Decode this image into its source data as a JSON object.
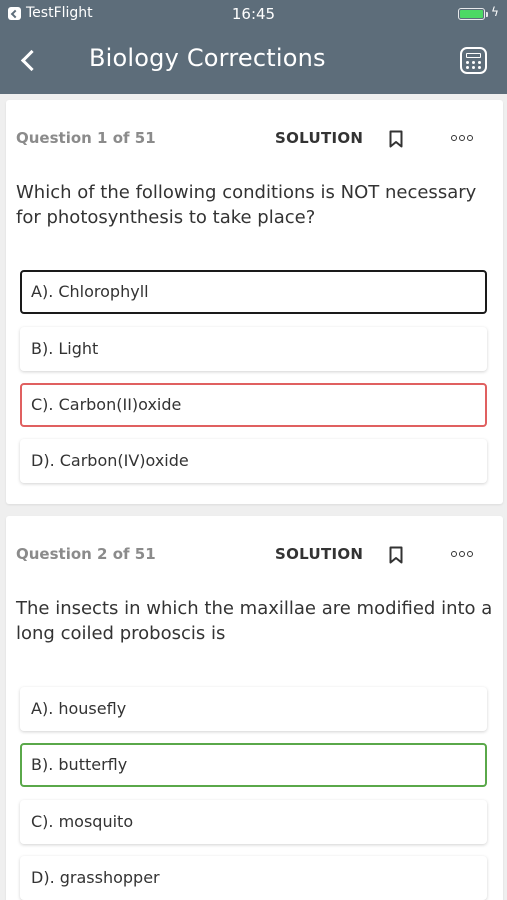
{
  "status_bar": {
    "app": "TestFlight",
    "time": "16:45",
    "charging_icon": "bolt-icon"
  },
  "header": {
    "title": "Biology Corrections",
    "back_icon": "chevron-left-icon",
    "calculator_icon": "calculator-icon"
  },
  "colors": {
    "header_bg": "#5d6d7a",
    "selected_border": "#1a1a1a",
    "wrong_border": "#e06060",
    "correct_border": "#5aa84a"
  },
  "questions": [
    {
      "counter": "Question 1 of 51",
      "solution_label": "SOLUTION",
      "text": "Which of the following conditions is NOT necessary for photosynthesis to take place?",
      "options": [
        {
          "label": "A).  Chlorophyll",
          "state": "selected"
        },
        {
          "label": "B).  Light",
          "state": "normal"
        },
        {
          "label": "C).  Carbon(II)oxide",
          "state": "wrong"
        },
        {
          "label": "D).  Carbon(IV)oxide",
          "state": "normal"
        }
      ]
    },
    {
      "counter": "Question 2 of 51",
      "solution_label": "SOLUTION",
      "text": "The insects in which the maxillae are modified into a long coiled proboscis is",
      "options": [
        {
          "label": "A).  housefly",
          "state": "normal"
        },
        {
          "label": "B).  butterfly",
          "state": "correct"
        },
        {
          "label": "C).  mosquito",
          "state": "normal"
        },
        {
          "label": "D).  grasshopper",
          "state": "normal"
        }
      ]
    }
  ]
}
